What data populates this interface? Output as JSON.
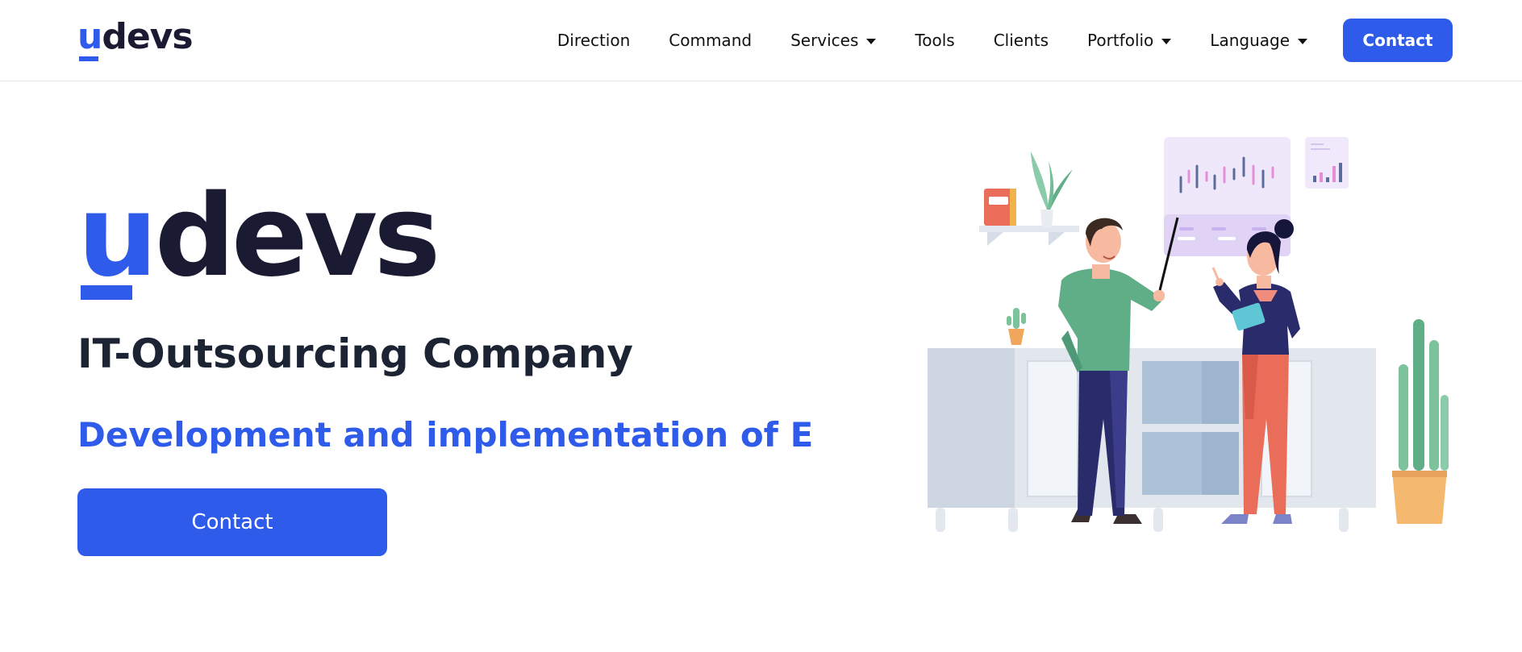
{
  "brand": {
    "logo_u": "u",
    "logo_rest": "devs"
  },
  "nav": {
    "items": [
      {
        "label": "Direction",
        "has_dropdown": false
      },
      {
        "label": "Command",
        "has_dropdown": false
      },
      {
        "label": "Services",
        "has_dropdown": true
      },
      {
        "label": "Tools",
        "has_dropdown": false
      },
      {
        "label": "Clients",
        "has_dropdown": false
      },
      {
        "label": "Portfolio",
        "has_dropdown": true
      },
      {
        "label": "Language",
        "has_dropdown": true
      }
    ],
    "contact_label": "Contact"
  },
  "hero": {
    "title": "IT-Outsourcing Company",
    "subtitle": "Development and implementation of E",
    "contact_label": "Contact"
  },
  "colors": {
    "accent": "#2f5bea",
    "dark": "#1b1a33"
  }
}
